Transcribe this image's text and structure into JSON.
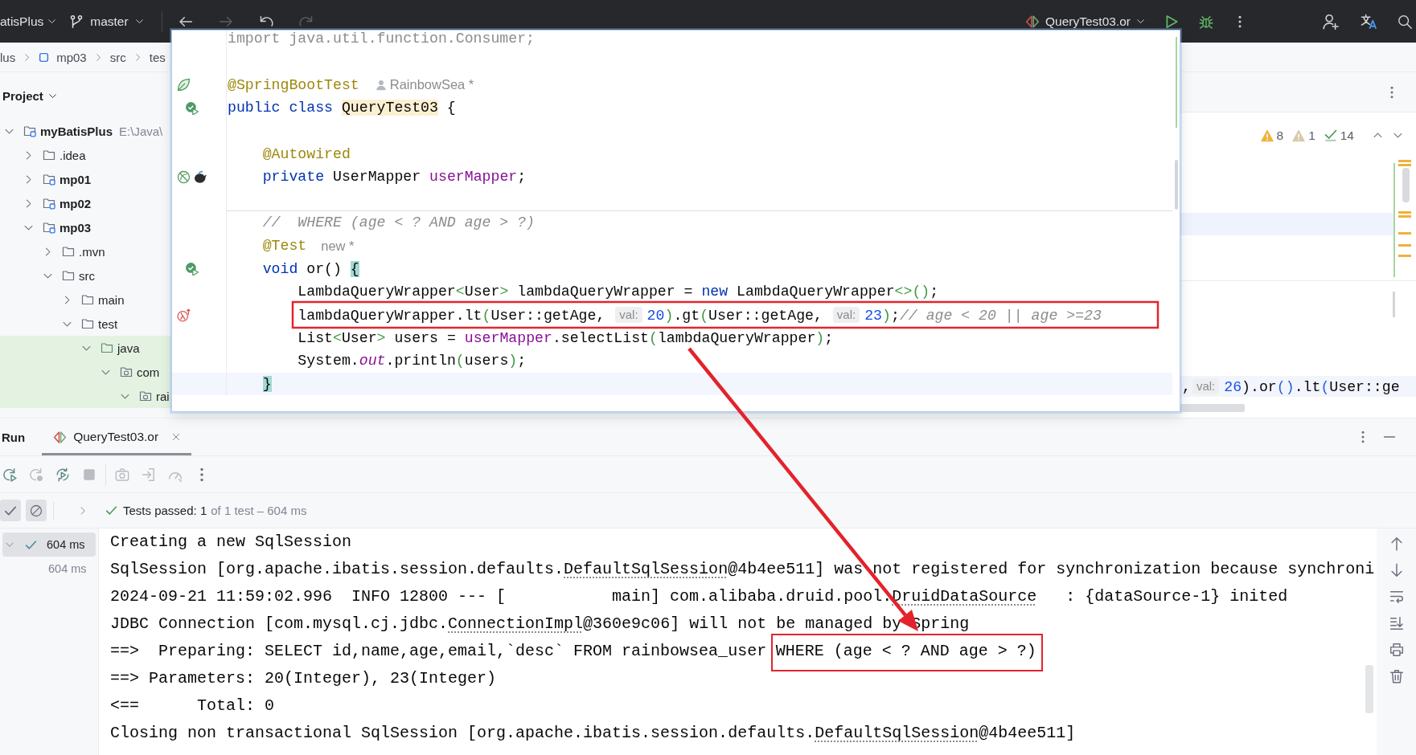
{
  "toolbar": {
    "project": "atisPlus",
    "branch": "master",
    "nav": [
      {
        "kind": "back",
        "disabled": false
      },
      {
        "kind": "forward",
        "disabled": true
      },
      {
        "kind": "undo",
        "disabled": false
      },
      {
        "kind": "redo",
        "disabled": true
      }
    ],
    "run_config": "QueryTest03.or"
  },
  "breadcrumbs": [
    {
      "kind": "plain",
      "label": "lus"
    },
    {
      "kind": "module",
      "label": "mp03"
    },
    {
      "kind": "plain",
      "label": "src"
    },
    {
      "kind": "plain",
      "label": "tes"
    }
  ],
  "project": {
    "title": "Project",
    "tree": [
      {
        "label": "myBatisPlus",
        "path": "E:\\Java\\",
        "kind": "module",
        "expanded": true,
        "test_scope": false,
        "children": [
          {
            "label": ".idea",
            "kind": "folder",
            "expanded": false,
            "test_scope": false
          },
          {
            "label": "mp01",
            "kind": "module",
            "expanded": false,
            "test_scope": false
          },
          {
            "label": "mp02",
            "kind": "module",
            "expanded": false,
            "test_scope": false
          },
          {
            "label": "mp03",
            "kind": "module",
            "expanded": true,
            "test_scope": false,
            "children": [
              {
                "label": ".mvn",
                "kind": "folder",
                "expanded": false,
                "test_scope": false
              },
              {
                "label": "src",
                "kind": "folder",
                "expanded": true,
                "test_scope": false,
                "children": [
                  {
                    "label": "main",
                    "kind": "folder",
                    "expanded": false,
                    "test_scope": false
                  },
                  {
                    "label": "test",
                    "kind": "folder",
                    "expanded": true,
                    "test_scope": false,
                    "children": [
                      {
                        "label": "java",
                        "kind": "test-root",
                        "expanded": true,
                        "test_scope": true,
                        "children": [
                          {
                            "label": "com",
                            "kind": "package",
                            "expanded": true,
                            "test_scope": true,
                            "children": [
                              {
                                "label": "rai",
                                "kind": "package",
                                "expanded": true,
                                "test_scope": true
                              }
                            ]
                          }
                        ]
                      }
                    ]
                  }
                ]
              }
            ]
          }
        ]
      }
    ]
  },
  "code_popup": {
    "lines": [
      {
        "kind": "code",
        "current": false,
        "separator_below": false,
        "tokens": [
          {
            "kind": "unused",
            "text": "import java.util.function.Consumer;"
          }
        ]
      },
      {
        "kind": "blank",
        "current": false,
        "separator_below": false
      },
      {
        "kind": "code",
        "current": false,
        "separator_below": false,
        "tokens": [
          {
            "kind": "annotation",
            "text": "@SpringBootTest"
          }
        ],
        "hint": {
          "kind": "author",
          "text": "RainbowSea *"
        }
      },
      {
        "kind": "code",
        "current": false,
        "separator_below": false,
        "tokens": [
          {
            "kind": "keyword",
            "text": "public class "
          },
          {
            "kind": "usage",
            "text": "QueryTest03"
          },
          {
            "kind": "plain",
            "text": " {"
          }
        ]
      },
      {
        "kind": "blank",
        "current": false,
        "separator_below": false
      },
      {
        "kind": "code",
        "current": false,
        "separator_below": false,
        "tokens": [
          {
            "kind": "annotation",
            "text": "    @Autowired"
          }
        ]
      },
      {
        "kind": "code",
        "current": false,
        "separator_below": false,
        "tokens": [
          {
            "kind": "keyword",
            "text": "    private"
          },
          {
            "kind": "plain",
            "text": " UserMapper "
          },
          {
            "kind": "field",
            "text": "userMapper"
          },
          {
            "kind": "plain",
            "text": ";"
          }
        ]
      },
      {
        "kind": "blank",
        "current": false,
        "separator_below": true
      },
      {
        "kind": "code",
        "current": false,
        "separator_below": false,
        "tokens": [
          {
            "kind": "comment",
            "text": "    //  WHERE (age < ? AND age > ?)"
          }
        ]
      },
      {
        "kind": "code",
        "current": false,
        "separator_below": false,
        "tokens": [
          {
            "kind": "annotation",
            "text": "    @Test"
          }
        ],
        "hint": {
          "kind": "plain",
          "text": "new *"
        }
      },
      {
        "kind": "code",
        "current": false,
        "separator_below": false,
        "tokens": [
          {
            "kind": "keyword",
            "text": "    void"
          },
          {
            "kind": "plain",
            "text": " or() "
          },
          {
            "kind": "brace",
            "text": "{"
          }
        ]
      },
      {
        "kind": "code",
        "current": false,
        "separator_below": false,
        "tokens": [
          {
            "kind": "plain",
            "text": "        LambdaQueryWrapper"
          },
          {
            "kind": "bracket",
            "text": "<"
          },
          {
            "kind": "plain",
            "text": "User"
          },
          {
            "kind": "bracket",
            "text": ">"
          },
          {
            "kind": "plain",
            "text": " lambdaQueryWrapper = "
          },
          {
            "kind": "keyword",
            "text": "new"
          },
          {
            "kind": "plain",
            "text": " LambdaQueryWrapper"
          },
          {
            "kind": "bracket",
            "text": "<>()"
          },
          {
            "kind": "plain",
            "text": ";"
          }
        ]
      },
      {
        "kind": "code",
        "current": false,
        "separator_below": false,
        "tokens": [
          {
            "kind": "plain",
            "text": "        lambdaQueryWrapper.lt"
          },
          {
            "kind": "bracket",
            "text": "("
          },
          {
            "kind": "plain",
            "text": "User::getAge, "
          },
          {
            "kind": "inlay",
            "text": "val:"
          },
          {
            "kind": "number",
            "text": "20"
          },
          {
            "kind": "bracket",
            "text": ")"
          },
          {
            "kind": "plain",
            "text": ".gt"
          },
          {
            "kind": "bracket",
            "text": "("
          },
          {
            "kind": "plain",
            "text": "User::getAge, "
          },
          {
            "kind": "inlay",
            "text": "val:"
          },
          {
            "kind": "number",
            "text": "23"
          },
          {
            "kind": "bracket",
            "text": ")"
          },
          {
            "kind": "plain",
            "text": ";"
          },
          {
            "kind": "comment",
            "text": "// age < 20 || age >=23"
          }
        ]
      },
      {
        "kind": "code",
        "current": false,
        "separator_below": false,
        "tokens": [
          {
            "kind": "plain",
            "text": "        List"
          },
          {
            "kind": "bracket",
            "text": "<"
          },
          {
            "kind": "plain",
            "text": "User"
          },
          {
            "kind": "bracket",
            "text": ">"
          },
          {
            "kind": "plain",
            "text": " users = "
          },
          {
            "kind": "field",
            "text": "userMapper"
          },
          {
            "kind": "plain",
            "text": ".selectList"
          },
          {
            "kind": "bracket",
            "text": "("
          },
          {
            "kind": "plain",
            "text": "lambdaQueryWrapper"
          },
          {
            "kind": "bracket",
            "text": ")"
          },
          {
            "kind": "plain",
            "text": ";"
          }
        ]
      },
      {
        "kind": "code",
        "current": false,
        "separator_below": false,
        "tokens": [
          {
            "kind": "plain",
            "text": "        System."
          },
          {
            "kind": "static",
            "text": "out"
          },
          {
            "kind": "plain",
            "text": ".println"
          },
          {
            "kind": "bracket",
            "text": "("
          },
          {
            "kind": "plain",
            "text": "users"
          },
          {
            "kind": "bracket",
            "text": ")"
          },
          {
            "kind": "plain",
            "text": ";"
          }
        ]
      },
      {
        "kind": "code",
        "current": true,
        "separator_below": false,
        "tokens": [
          {
            "kind": "brace",
            "text": "    }"
          }
        ]
      }
    ]
  },
  "editor": {
    "inspections": [
      {
        "kind": "warning",
        "count": "8"
      },
      {
        "kind": "weak-warning",
        "count": "1"
      },
      {
        "kind": "typo",
        "count": "14"
      }
    ],
    "line": {
      "current": true,
      "tokens": [
        {
          "kind": "plain",
          "text": ","
        },
        {
          "kind": "inlay",
          "text": "val:"
        },
        {
          "kind": "number",
          "text": "26"
        },
        {
          "kind": "plain",
          "text": ").or"
        },
        {
          "kind": "bracket2",
          "text": "()"
        },
        {
          "kind": "plain",
          "text": ".lt"
        },
        {
          "kind": "bracket2",
          "text": "("
        },
        {
          "kind": "plain",
          "text": "User::ge"
        }
      ]
    }
  },
  "run": {
    "title": "Run",
    "tabs": [
      {
        "label": "QueryTest03.or",
        "selected": true
      }
    ],
    "tools": [
      {
        "kind": "rerun",
        "disabled": false
      },
      {
        "kind": "rerun_failed",
        "disabled": true
      },
      {
        "kind": "toggle_auto",
        "disabled": false
      },
      {
        "kind": "stop",
        "disabled": true
      },
      {
        "kind": "snapshot",
        "disabled": true
      },
      {
        "kind": "export",
        "disabled": true
      },
      {
        "kind": "profile",
        "disabled": true
      },
      {
        "kind": "more",
        "disabled": false
      }
    ],
    "filters": [
      {
        "kind": "passed",
        "on": true
      },
      {
        "kind": "ignored",
        "on": true
      }
    ],
    "status": {
      "summary": "Tests passed: 1",
      "detail": "of 1 test – 604 ms"
    },
    "tests": [
      {
        "duration": "604 ms",
        "kind": "passed",
        "expanded": true,
        "selected": true,
        "children": [
          {
            "duration": "604 ms",
            "selected": false
          }
        ]
      }
    ],
    "console": [
      [
        {
          "kind": "text",
          "text": "Creating a new SqlSession"
        }
      ],
      [
        {
          "kind": "text",
          "text": "SqlSession [org.apache.ibatis.session.defaults."
        },
        {
          "kind": "link",
          "text": "DefaultSqlSession"
        },
        {
          "kind": "text",
          "text": "@4b4ee511] was not registered for synchronization because synchroni"
        }
      ],
      [
        {
          "kind": "text",
          "text": "2024-09-21 11:59:02.996  INFO 12800 --- [           main] com.alibaba.druid.pool."
        },
        {
          "kind": "link",
          "text": "DruidDataSource"
        },
        {
          "kind": "text",
          "text": "   : {dataSource-1} inited"
        }
      ],
      [
        {
          "kind": "text",
          "text": "JDBC Connection [com.mysql.cj.jdbc."
        },
        {
          "kind": "link",
          "text": "ConnectionImpl"
        },
        {
          "kind": "text",
          "text": "@360e9c06] will not be managed by Spring"
        }
      ],
      [
        {
          "kind": "text",
          "text": "==>  Preparing: SELECT id,name,age,email,`desc` FROM rainbowsea_user "
        },
        {
          "kind": "boxed",
          "text": "WHERE (age < ? AND age > ?)"
        }
      ],
      [
        {
          "kind": "text",
          "text": "==> Parameters: 20(Integer), 23(Integer)"
        }
      ],
      [
        {
          "kind": "text",
          "text": "<==      Total: 0"
        }
      ],
      [
        {
          "kind": "text",
          "text": "Closing non transactional SqlSession [org.apache.ibatis.session.defaults."
        },
        {
          "kind": "link",
          "text": "DefaultSqlSession"
        },
        {
          "kind": "text",
          "text": "@4b4ee511]"
        }
      ]
    ]
  }
}
